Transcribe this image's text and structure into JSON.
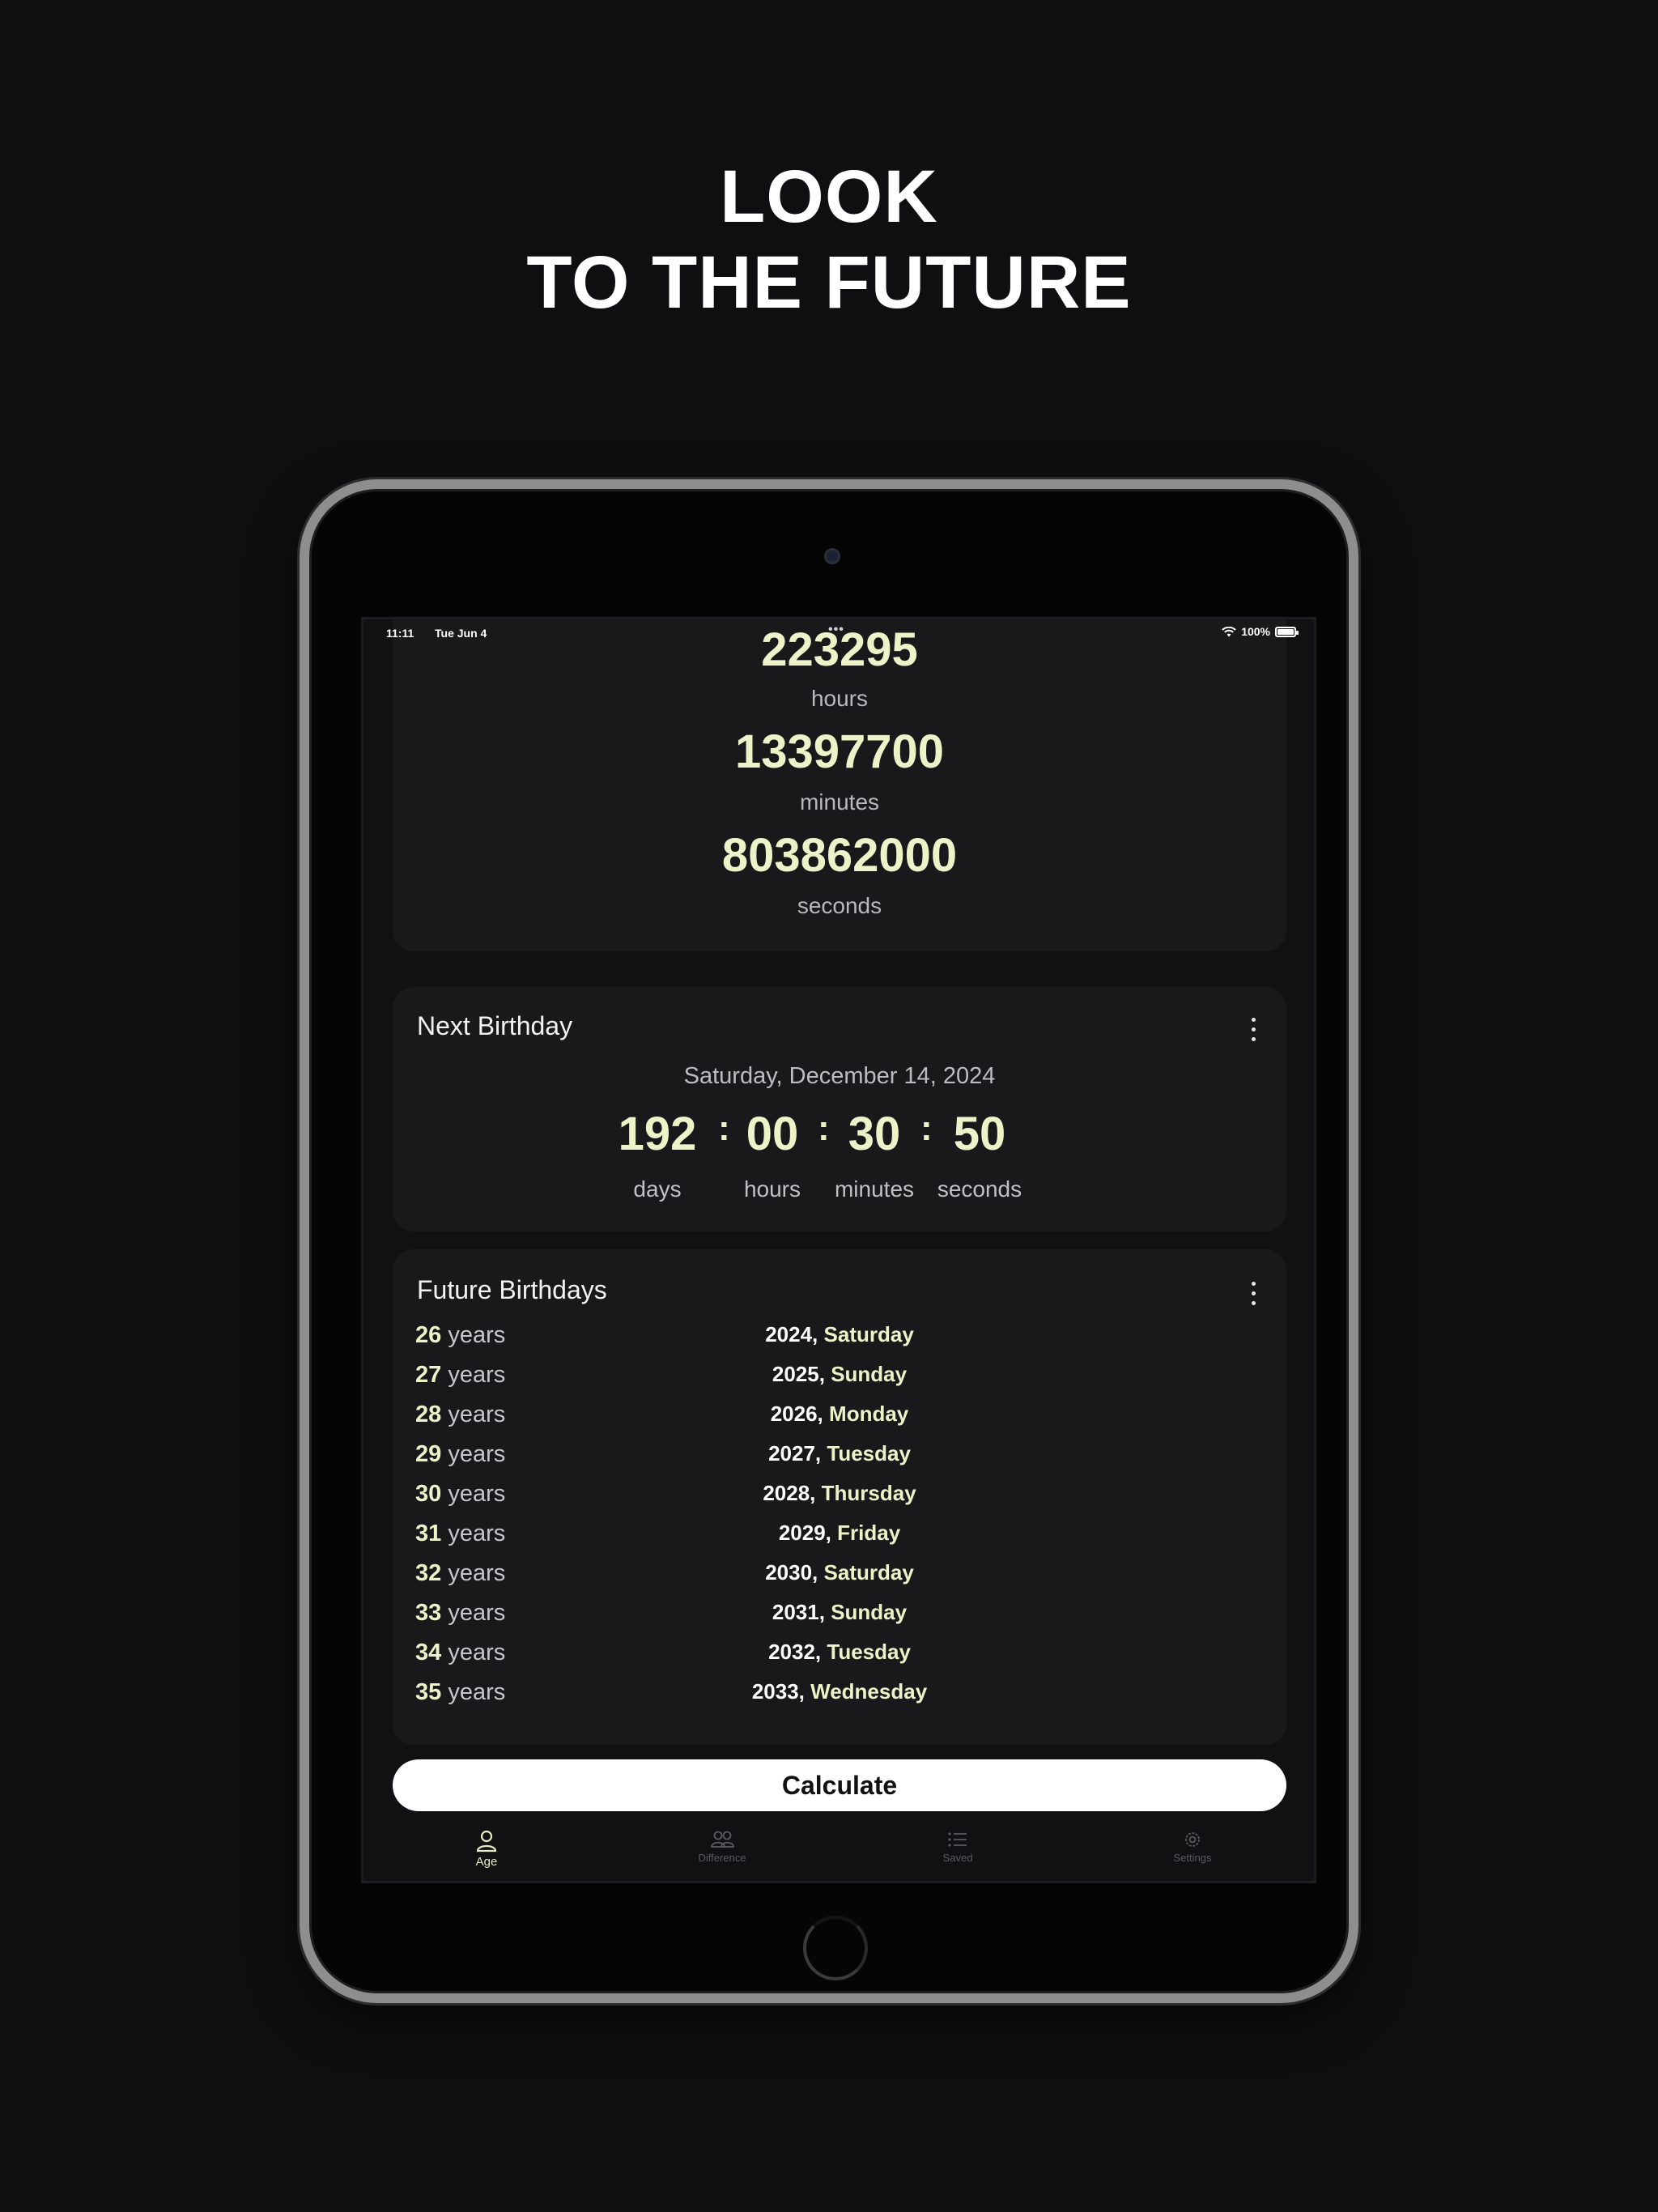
{
  "headline": {
    "line1": "LOOK",
    "line2": "TO THE FUTURE"
  },
  "status_bar": {
    "time": "11:11",
    "date": "Tue Jun 4",
    "dots": "•••",
    "battery": "100%"
  },
  "totals": [
    {
      "value": "223295",
      "unit": "hours"
    },
    {
      "value": "13397700",
      "unit": "minutes"
    },
    {
      "value": "803862000",
      "unit": "seconds"
    }
  ],
  "next_birthday": {
    "title": "Next Birthday",
    "date": "Saturday, December 14, 2024",
    "separator": ":",
    "countdown": [
      {
        "value": "192",
        "label": "days"
      },
      {
        "value": "00",
        "label": "hours"
      },
      {
        "value": "30",
        "label": "minutes"
      },
      {
        "value": "50",
        "label": "seconds"
      }
    ]
  },
  "future_birthdays": {
    "title": "Future Birthdays",
    "years_word": "years",
    "rows": [
      {
        "age": "26",
        "year": "2024,",
        "day": "Saturday"
      },
      {
        "age": "27",
        "year": "2025,",
        "day": "Sunday"
      },
      {
        "age": "28",
        "year": "2026,",
        "day": "Monday"
      },
      {
        "age": "29",
        "year": "2027,",
        "day": "Tuesday"
      },
      {
        "age": "30",
        "year": "2028,",
        "day": "Thursday"
      },
      {
        "age": "31",
        "year": "2029,",
        "day": "Friday"
      },
      {
        "age": "32",
        "year": "2030,",
        "day": "Saturday"
      },
      {
        "age": "33",
        "year": "2031,",
        "day": "Sunday"
      },
      {
        "age": "34",
        "year": "2032,",
        "day": "Tuesday"
      },
      {
        "age": "35",
        "year": "2033,",
        "day": "Wednesday"
      }
    ]
  },
  "calculate_label": "Calculate",
  "tabs": [
    {
      "label": "Age",
      "icon": "person-icon",
      "active": true
    },
    {
      "label": "Difference",
      "icon": "people-icon",
      "active": false
    },
    {
      "label": "Saved",
      "icon": "list-icon",
      "active": false
    },
    {
      "label": "Settings",
      "icon": "gear-icon",
      "active": false
    }
  ],
  "colors": {
    "accent": "#eef2c8",
    "background": "#0f0f11",
    "card": "#19191c"
  }
}
